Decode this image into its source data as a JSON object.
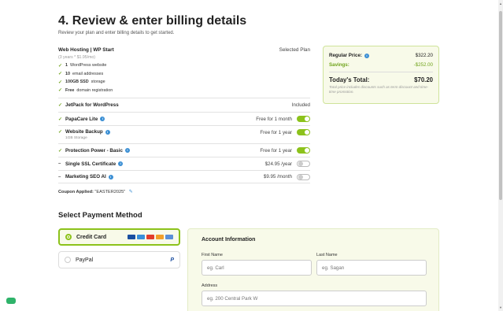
{
  "header": {
    "title": "4. Review & enter billing details",
    "subtitle": "Review your plan and enter billing details to get started."
  },
  "plan": {
    "name": "Web Hosting | WP Start",
    "selected_label": "Selected Plan",
    "term": "(3 years * $1.95/mo)",
    "features": [
      {
        "bold": "1",
        "text": "WordPress website"
      },
      {
        "bold": "10",
        "text": "email addresses"
      },
      {
        "bold": "100GB SSD",
        "text": "storage"
      },
      {
        "bold": "Free",
        "text": "domain registration"
      }
    ]
  },
  "addons": [
    {
      "name": "JetPack for WordPress",
      "status": "Included",
      "state": "included"
    },
    {
      "name": "PapaCare Lite",
      "status": "Free for 1 month",
      "state": "on",
      "info": true
    },
    {
      "name": "Website Backup",
      "status": "Free for 1 year",
      "state": "on",
      "info": true,
      "note": "1GB Storage"
    },
    {
      "name": "Protection Power - Basic",
      "status": "Free for 1 year",
      "state": "on",
      "info": true
    },
    {
      "name": "Single SSL Certificate",
      "status": "$24.95 /year",
      "state": "off",
      "info": true
    },
    {
      "name": "Marketing SEO AI",
      "status": "$9.95 /month",
      "state": "off",
      "info": true
    }
  ],
  "coupon": {
    "label": "Coupon Applied:",
    "code": "\"EASTER2025\""
  },
  "pricing": {
    "regular_label": "Regular Price:",
    "regular_value": "$322.20",
    "savings_label": "Savings:",
    "savings_value": "-$252.00",
    "total_label": "Today's Total:",
    "total_value": "$70.20",
    "note": "Total price includes discounts such as term discount and time-time promotion."
  },
  "payment": {
    "title": "Select Payment Method",
    "credit_card": "Credit Card",
    "paypal": "PayPal",
    "paypal_icon": "P",
    "card_colors": [
      "#1a4fa0",
      "#3a8fd9",
      "#e23c2b",
      "#f0a02a",
      "#5a8fd6"
    ]
  },
  "account": {
    "title": "Account Information",
    "first_name_label": "First Name",
    "first_name_placeholder": "eg. Carl",
    "last_name_label": "Last Name",
    "last_name_placeholder": "eg. Sagan",
    "address_label": "Address",
    "address_placeholder": "eg. 200 Central Park W"
  }
}
